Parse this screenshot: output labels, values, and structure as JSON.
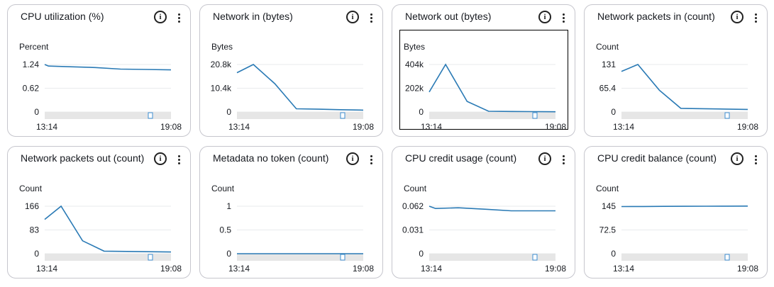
{
  "colors": {
    "line": "#2a7ab5",
    "grid": "#e9ebed",
    "scrollbar": "#e6e6e6",
    "handle": "#3d8fd1"
  },
  "icons": {
    "info": "info-circle-icon",
    "menu": "more-vertical-icon"
  },
  "info_glyph": "i",
  "widgets": [
    {
      "title": "CPU utilization (%)",
      "unit": "Percent",
      "yticks": [
        "1.24",
        "0.62",
        "0"
      ],
      "ymax": 1.24,
      "xlabels": [
        "13:14",
        "19:08"
      ],
      "values": [
        1.24,
        1.2,
        1.18,
        1.16,
        1.12,
        1.11,
        1.1
      ],
      "x": [
        0.0,
        0.03,
        0.2,
        0.4,
        0.6,
        0.8,
        1.0
      ]
    },
    {
      "title": "Network in (bytes)",
      "unit": "Bytes",
      "yticks": [
        "20.8k",
        "10.4k",
        "0"
      ],
      "ymax": 20800,
      "xlabels": [
        "13:14",
        "19:08"
      ],
      "values": [
        17200,
        20800,
        12400,
        1400,
        1200,
        1000,
        800
      ],
      "x": [
        0.0,
        0.13,
        0.3,
        0.47,
        0.65,
        0.82,
        1.0
      ]
    },
    {
      "title": "Network out (bytes)",
      "unit": "Bytes",
      "yticks": [
        "404k",
        "202k",
        "0"
      ],
      "ymax": 404000,
      "xlabels": [
        "13:14",
        "19:08"
      ],
      "values": [
        170000,
        404000,
        90000,
        6000,
        4000,
        3000,
        2000
      ],
      "x": [
        0.0,
        0.13,
        0.3,
        0.47,
        0.65,
        0.82,
        1.0
      ]
    },
    {
      "title": "Network packets in (count)",
      "unit": "Count",
      "yticks": [
        "131",
        "65.4",
        "0"
      ],
      "ymax": 131,
      "xlabels": [
        "13:14",
        "19:08"
      ],
      "values": [
        112,
        131,
        60,
        10,
        9,
        8,
        7
      ],
      "x": [
        0.0,
        0.13,
        0.3,
        0.47,
        0.65,
        0.82,
        1.0
      ]
    },
    {
      "title": "Network packets out (count)",
      "unit": "Count",
      "yticks": [
        "166",
        "83",
        "0"
      ],
      "ymax": 166,
      "xlabels": [
        "13:14",
        "19:08"
      ],
      "values": [
        120,
        166,
        45,
        9,
        8,
        7,
        6
      ],
      "x": [
        0.0,
        0.13,
        0.3,
        0.47,
        0.65,
        0.82,
        1.0
      ]
    },
    {
      "title": "Metadata no token (count)",
      "unit": "Count",
      "yticks": [
        "1",
        "0.5",
        "0"
      ],
      "ymax": 1,
      "xlabels": [
        "13:14",
        "19:08"
      ],
      "values": [
        0,
        0,
        0,
        0,
        0,
        0,
        0
      ],
      "x": [
        0.0,
        0.17,
        0.33,
        0.5,
        0.67,
        0.83,
        1.0
      ]
    },
    {
      "title": "CPU credit usage (count)",
      "unit": "Count",
      "yticks": [
        "0.062",
        "0.031",
        "0"
      ],
      "ymax": 0.062,
      "xlabels": [
        "13:14",
        "19:08"
      ],
      "values": [
        0.062,
        0.059,
        0.06,
        0.058,
        0.056,
        0.056,
        0.056
      ],
      "x": [
        0.0,
        0.05,
        0.23,
        0.45,
        0.65,
        0.82,
        1.0
      ]
    },
    {
      "title": "CPU credit balance (count)",
      "unit": "Count",
      "yticks": [
        "145",
        "72.5",
        "0"
      ],
      "ymax": 145,
      "xlabels": [
        "13:14",
        "19:08"
      ],
      "values": [
        144,
        144.2,
        144.5,
        144.8,
        145,
        145.2,
        145.4
      ],
      "x": [
        0.0,
        0.17,
        0.33,
        0.5,
        0.67,
        0.83,
        1.0
      ]
    }
  ]
}
